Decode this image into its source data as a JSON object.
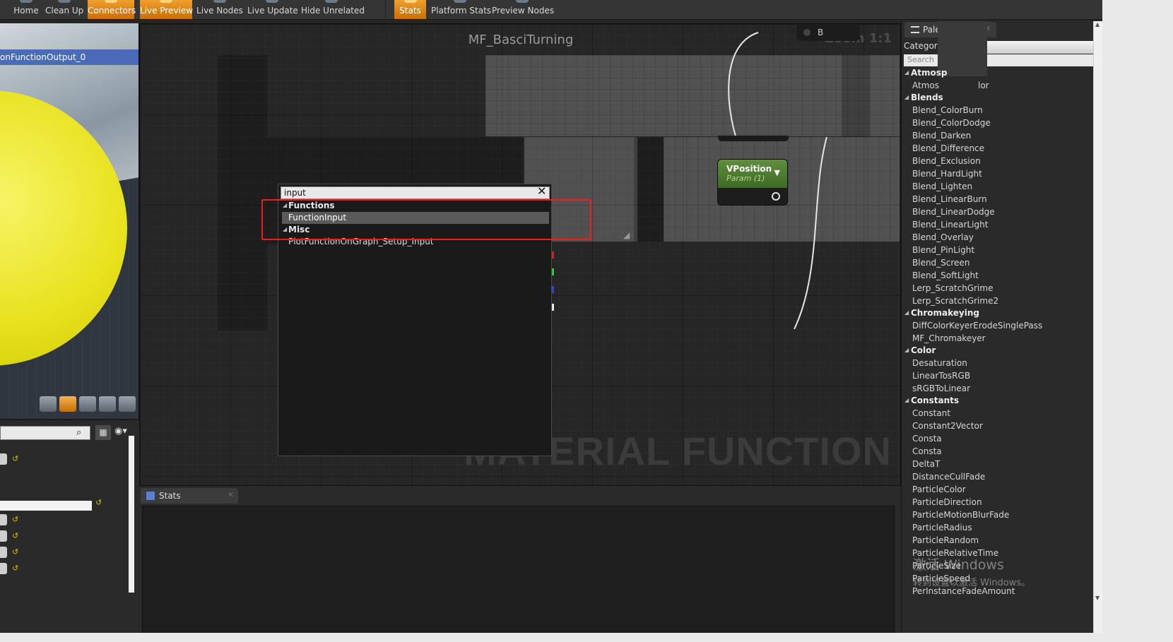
{
  "toolbar": {
    "buttons": [
      {
        "label": "Home",
        "active": false
      },
      {
        "label": "Clean Up",
        "active": false
      },
      {
        "label": "Connectors",
        "active": true
      },
      {
        "label": "Live Preview",
        "active": true
      },
      {
        "label": "Live Nodes",
        "active": false
      },
      {
        "label": "Live Update",
        "active": false
      },
      {
        "label": "Hide Unrelated",
        "active": false
      },
      {
        "label": "Stats",
        "active": true
      },
      {
        "label": "Platform Stats",
        "active": false
      },
      {
        "label": "Preview Nodes",
        "active": false
      }
    ]
  },
  "viewport": {
    "selected_strip": "onFunctionOutput_0"
  },
  "graph": {
    "title": "MF_BasciTurning",
    "zoom": "Zoom 1:1",
    "watermark": "MATERIAL FUNCTION",
    "node_b": {
      "label": "B"
    },
    "node_vposition": {
      "title": "VPosition",
      "subtitle": "Param (1)"
    }
  },
  "search_popup": {
    "query": "input",
    "categories": [
      {
        "name": "Functions",
        "items": [
          {
            "label": "FunctionInput",
            "selected": true
          }
        ]
      },
      {
        "name": "Misc",
        "items": [
          {
            "label": "PlotFunctionOnGraph_Setup_Input",
            "selected": false
          }
        ]
      }
    ]
  },
  "stats_panel": {
    "tab_label": "Stats"
  },
  "palette": {
    "tab_label": "Pale",
    "category_label": "Category:",
    "search_placeholder": "Search",
    "groups": [
      {
        "name": "Atmosp",
        "items": [
          "Atmos",
          "lor"
        ]
      },
      {
        "name": "Blends",
        "items": [
          "Blend_ColorBurn",
          "Blend_ColorDodge",
          "Blend_Darken",
          "Blend_Difference",
          "Blend_Exclusion",
          "Blend_HardLight",
          "Blend_Lighten",
          "Blend_LinearBurn",
          "Blend_LinearDodge",
          "Blend_LinearLight",
          "Blend_Overlay",
          "Blend_PinLight",
          "Blend_Screen",
          "Blend_SoftLight",
          "Lerp_ScratchGrime",
          "Lerp_ScratchGrime2"
        ]
      },
      {
        "name": "Chromakeying",
        "items": [
          "DiffColorKeyerErodeSinglePass",
          "MF_Chromakeyer"
        ]
      },
      {
        "name": "Color",
        "items": [
          "Desaturation",
          "LinearTosRGB",
          "sRGBToLinear"
        ]
      },
      {
        "name": "Constants",
        "items": [
          "Constant",
          "Constant2Vector",
          "Consta",
          "Consta",
          "DeltaT",
          "DistanceCullFade",
          "ParticleColor",
          "ParticleDirection",
          "ParticleMotionBlurFade",
          "ParticleRadius",
          "ParticleRandom",
          "ParticleRelativeTime",
          "ParticleSize",
          "ParticleSpeed",
          "PerInstanceFadeAmount"
        ]
      }
    ]
  },
  "os_watermark": {
    "line1": "激活 Windows",
    "line2": "转到设置以激活 Windows。"
  }
}
